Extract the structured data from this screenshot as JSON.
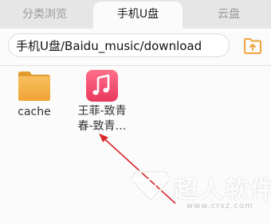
{
  "tabs": [
    {
      "label": "分类浏览",
      "active": false
    },
    {
      "label": "手机U盘",
      "active": true
    },
    {
      "label": "云盘",
      "active": false
    }
  ],
  "path": {
    "value": "手机U盘/Baidu_music/download"
  },
  "files": [
    {
      "name": "cache",
      "icon": "folder-icon"
    },
    {
      "name": "王菲-致青春-致青…",
      "icon": "music-file-icon"
    }
  ],
  "watermark": {
    "title": "超人软件",
    "url": "www.crxz.com"
  },
  "colors": {
    "accent_orange": "#f0a43c",
    "music_icon_start": "#ff6f8a",
    "music_icon_end": "#e8385e",
    "annotation_red": "#d8262a",
    "tab_bar_bg": "#e6e6e6"
  }
}
